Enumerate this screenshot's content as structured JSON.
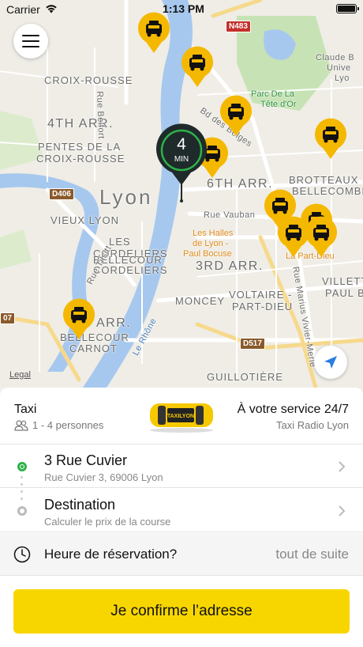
{
  "status_bar": {
    "carrier": "Carrier",
    "time": "1:13 PM"
  },
  "map": {
    "labels": {
      "croix_rousse": "CROIX-ROUSSE",
      "arr4": "4TH ARR.",
      "pentes": "PENTES DE LA",
      "pentes2": "CROIX-ROUSSE",
      "city": "Lyon",
      "vieux_lyon": "VIEUX LYON",
      "cordeliers": "LES",
      "cordeliers2": "CORDELIERS",
      "bellecour": "BELLECOUR",
      "bellecour2": "CORDELIERS",
      "arr6": "6TH ARR.",
      "brotteaux": "BROTTEAUX -",
      "brotteaux2": "BELLECOMBE",
      "arr3": "3RD ARR.",
      "villette": "VILLETTE",
      "villette2": "PAUL BERT",
      "moncey": "MONCEY",
      "voltaire": "VOLTAIRE -",
      "voltaire2": "PART-DIEU",
      "arr2": "ARR.",
      "bellecour_carnot": "BELLECOUR",
      "bellecour_carnot2": "CARNOT",
      "guillotiere": "GUILLOTIÈRE",
      "rue_vauban": "Rue Vauban",
      "rue_belfort": "Rue Belfort",
      "bd_des_belges": "Bd des Belges",
      "rue_tilsitt": "Rue Tilsitt",
      "le_rhone": "Le Rhône",
      "marius": "Rue Marius Vivier-Merle",
      "halles": "Les Halles",
      "halles2": "de Lyon -",
      "halles3": "Paul Bocuse",
      "part_dieu": "La Part-Dieu",
      "parc": "Parc De La",
      "parc2": "Tête d'Or",
      "claude": "Claude B",
      "claude2": "Unive",
      "claude3": "Lyo",
      "road_n483": "N483",
      "road_d406": "D406",
      "road_d517": "D517",
      "road_07": "07",
      "legal": "Legal"
    },
    "eta": {
      "value": "4",
      "unit": "MIN"
    }
  },
  "service": {
    "name": "Taxi",
    "capacity": "1 - 4 personnes",
    "availability": "À votre service 24/7",
    "company": "Taxi Radio Lyon",
    "car_label": "TAXILYON"
  },
  "pickup": {
    "title": "3 Rue Cuvier",
    "subtitle": "Rue Cuvier 3, 69006 Lyon"
  },
  "destination": {
    "title": "Destination",
    "subtitle": "Calculer le prix de la course"
  },
  "booking_time": {
    "label": "Heure de réservation?",
    "value": "tout de suite"
  },
  "confirm_button": "Je confirme l’adresse",
  "colors": {
    "accent": "#f7d600",
    "pin": "#f5b800",
    "eta_pin": "#1f2a2a",
    "river": "#a7c8ee",
    "park": "#c7e3b5"
  }
}
